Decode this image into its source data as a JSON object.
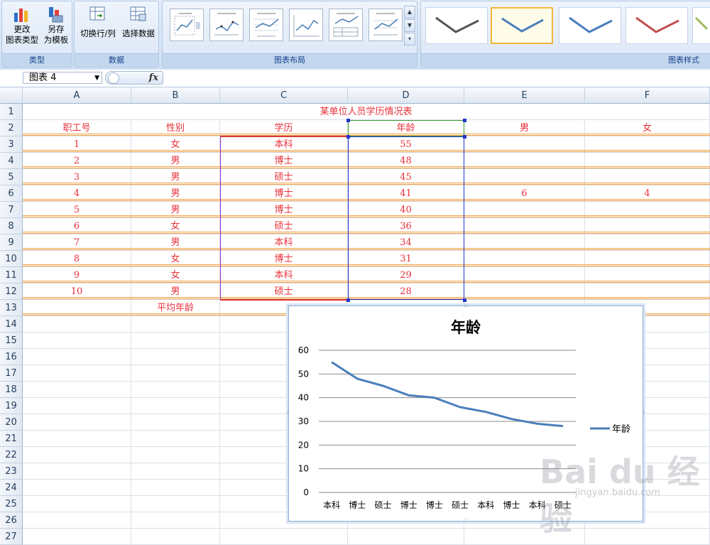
{
  "ribbon": {
    "type_group": {
      "label": "类型",
      "change_type_line1": "更改",
      "change_type_line2": "图表类型",
      "save_template_line1": "另存",
      "save_template_line2": "为模板"
    },
    "data_group": {
      "label": "数据",
      "switch_row_col": "切换行/列",
      "select_data": "选择数据"
    },
    "layout_group": {
      "label": "图表布局"
    },
    "styles_group": {
      "label": "图表样式"
    }
  },
  "formula_bar": {
    "name_box": "图表 4",
    "fx": "fx",
    "content": ""
  },
  "columns": [
    "A",
    "B",
    "C",
    "D",
    "E",
    "F"
  ],
  "rows": [
    "1",
    "2",
    "3",
    "4",
    "5",
    "6",
    "7",
    "8",
    "9",
    "10",
    "11",
    "12",
    "13",
    "14",
    "15",
    "16",
    "17",
    "18",
    "19",
    "20",
    "21",
    "22",
    "23",
    "24",
    "25",
    "26",
    "27"
  ],
  "sheet": {
    "title": "某单位人员学历情况表",
    "headers": [
      "职工号",
      "性别",
      "学历",
      "年龄",
      "男",
      "女"
    ],
    "records": [
      [
        "1",
        "女",
        "本科",
        "55"
      ],
      [
        "2",
        "男",
        "博士",
        "48"
      ],
      [
        "3",
        "男",
        "硕士",
        "45"
      ],
      [
        "4",
        "男",
        "博士",
        "41"
      ],
      [
        "5",
        "男",
        "博士",
        "40"
      ],
      [
        "6",
        "女",
        "硕士",
        "36"
      ],
      [
        "7",
        "男",
        "本科",
        "34"
      ],
      [
        "8",
        "女",
        "博士",
        "31"
      ],
      [
        "9",
        "女",
        "本科",
        "29"
      ],
      [
        "10",
        "男",
        "硕士",
        "28"
      ]
    ],
    "male_count": "6",
    "female_count": "4",
    "avg_label": "平均年龄"
  },
  "chart_data": {
    "type": "line",
    "title": "年龄",
    "categories": [
      "本科",
      "博士",
      "硕士",
      "博士",
      "博士",
      "硕士",
      "本科",
      "博士",
      "本科",
      "硕士"
    ],
    "series": [
      {
        "name": "年龄",
        "values": [
          55,
          48,
          45,
          41,
          40,
          36,
          34,
          31,
          29,
          28
        ],
        "color": "#4a7ebb"
      }
    ],
    "yticks": [
      "0",
      "10",
      "20",
      "30",
      "40",
      "50",
      "60"
    ],
    "ylim": [
      0,
      60
    ],
    "grid": true,
    "legend": "right"
  },
  "watermark": {
    "brand": "Bai du 经验",
    "url": "jingyan.baidu.com"
  },
  "colors": {
    "cell_text": "#e8303a",
    "line": "#4a7ebb",
    "ribbon": "#dbe7f6"
  }
}
